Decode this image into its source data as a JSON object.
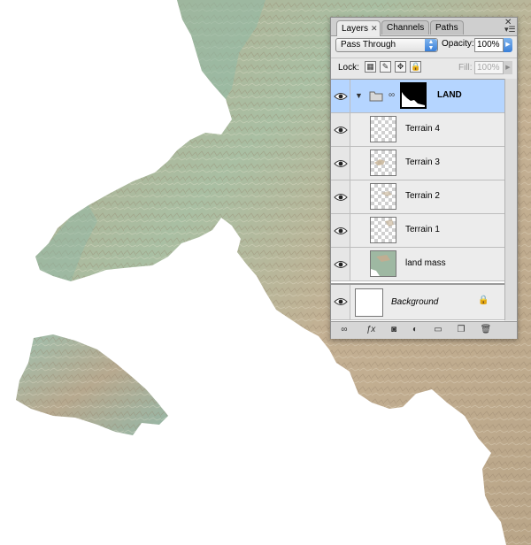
{
  "panel": {
    "tabs": [
      {
        "label": "Layers",
        "active": true
      },
      {
        "label": "Channels",
        "active": false
      },
      {
        "label": "Paths",
        "active": false
      }
    ],
    "blend_mode": "Pass Through",
    "opacity_label": "Opacity:",
    "opacity_value": "100%",
    "lock_label": "Lock:",
    "fill_label": "Fill:",
    "fill_value": "100%",
    "layers": [
      {
        "name": "LAND",
        "type": "group",
        "selected": true,
        "visible": true
      },
      {
        "name": "Terrain 4",
        "type": "layer",
        "selected": false,
        "visible": true
      },
      {
        "name": "Terrain 3",
        "type": "layer",
        "selected": false,
        "visible": true
      },
      {
        "name": "Terrain 2",
        "type": "layer",
        "selected": false,
        "visible": true
      },
      {
        "name": "Terrain 1",
        "type": "layer",
        "selected": false,
        "visible": true
      },
      {
        "name": "land mass",
        "type": "layer",
        "selected": false,
        "visible": true
      },
      {
        "name": "Background",
        "type": "background",
        "selected": false,
        "visible": true,
        "locked": true
      }
    ],
    "bottom_icons": [
      "link-icon",
      "fx-icon",
      "mask-icon",
      "adjustment-icon",
      "folder-icon",
      "new-layer-icon",
      "trash-icon"
    ]
  },
  "colors": {
    "selection": "#b5d5ff",
    "accent_blue": "#3a7fd8",
    "land_green": "#9ebca3",
    "land_tan": "#c7b094"
  }
}
